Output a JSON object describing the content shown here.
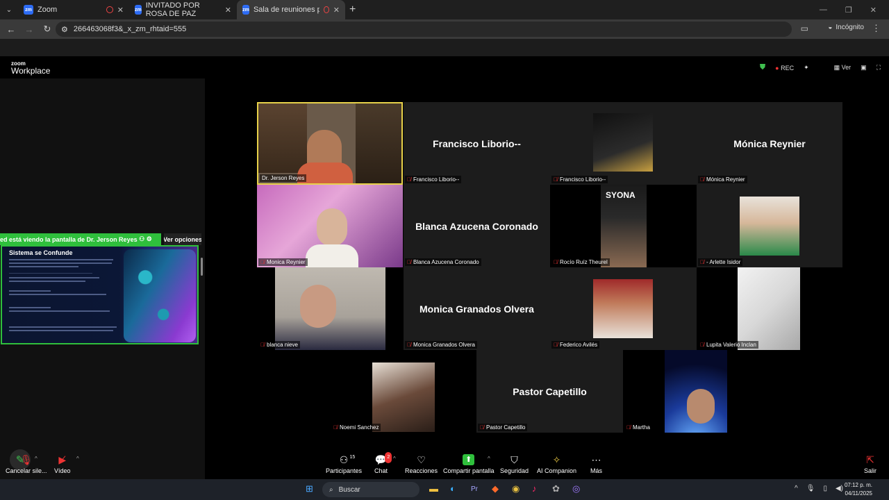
{
  "browser": {
    "tabs": [
      {
        "label": "Zoom",
        "active": false,
        "recording": true
      },
      {
        "label": "INVITADO POR ROSA DE PAZ",
        "active": false,
        "recording": false
      },
      {
        "label": "Sala de reuniones personal",
        "active": true,
        "recording": true
      }
    ],
    "address": "266463068f3&_x_zm_rhtaid=555",
    "incognito_label": "Incógnito"
  },
  "zoom": {
    "logo_top": "zoom",
    "logo_bottom": "Workplace",
    "rec_label": "REC",
    "view_label": "Ver",
    "share_banner": "ed está viendo la pantalla de  Dr. Jerson Reyes",
    "view_options": "Ver opciones",
    "slide_title": "Sistema se Confunde",
    "tiles": [
      {
        "id": "jerson",
        "label": "Dr. Jerson Reyes",
        "big": "",
        "muted": false,
        "selected": true
      },
      {
        "id": "francisco1",
        "label": "Francisco Liborio--",
        "big": "Francisco Liborio--",
        "muted": true
      },
      {
        "id": "francisco2",
        "label": "Francisco Liborio--",
        "big": "",
        "muted": true
      },
      {
        "id": "monica-reynier",
        "label": "Mónica Reynier",
        "big": "Mónica Reynier",
        "muted": true
      },
      {
        "id": "monica-reynier2",
        "label": "Monica Reynier",
        "big": "",
        "muted": true
      },
      {
        "id": "blanca-azucena",
        "label": "Blanca Azucena Coronado",
        "big": "Blanca Azucena Coronado",
        "muted": true
      },
      {
        "id": "rocio",
        "label": "Rocío Ruíz Theurel",
        "big": "",
        "muted": true
      },
      {
        "id": "arlette",
        "label": "- Arlette Isidor",
        "big": "",
        "muted": true
      },
      {
        "id": "blanca-nieve",
        "label": "blanca nieve",
        "big": "",
        "muted": true
      },
      {
        "id": "monica-granados",
        "label": "Monica Granados Olvera",
        "big": "Monica Granados Olvera",
        "muted": true
      },
      {
        "id": "federico",
        "label": "Federico Avilés",
        "big": "",
        "muted": true
      },
      {
        "id": "lupita",
        "label": "Lupita Valerio Inclan",
        "big": "",
        "muted": true
      },
      {
        "id": "noemi",
        "label": "Noemi Sanchez",
        "big": "",
        "muted": true
      },
      {
        "id": "pastor",
        "label": "Pastor Capetillo",
        "big": "Pastor Capetillo",
        "muted": true
      },
      {
        "id": "martha",
        "label": "Martha",
        "big": "",
        "muted": true
      }
    ],
    "toolbar": {
      "mute": "Cancelar sile...",
      "video": "Vídeo",
      "participants": "Participantes",
      "participants_count": "15",
      "chat": "Chat",
      "chat_badge": "2",
      "reactions": "Reacciones",
      "share": "Compartir pantalla",
      "security": "Seguridad",
      "ai": "AI Companion",
      "more": "Más",
      "leave": "Salir"
    }
  },
  "taskbar": {
    "search": "Buscar",
    "time": "07:12 p. m.",
    "date": "04/11/2025"
  }
}
